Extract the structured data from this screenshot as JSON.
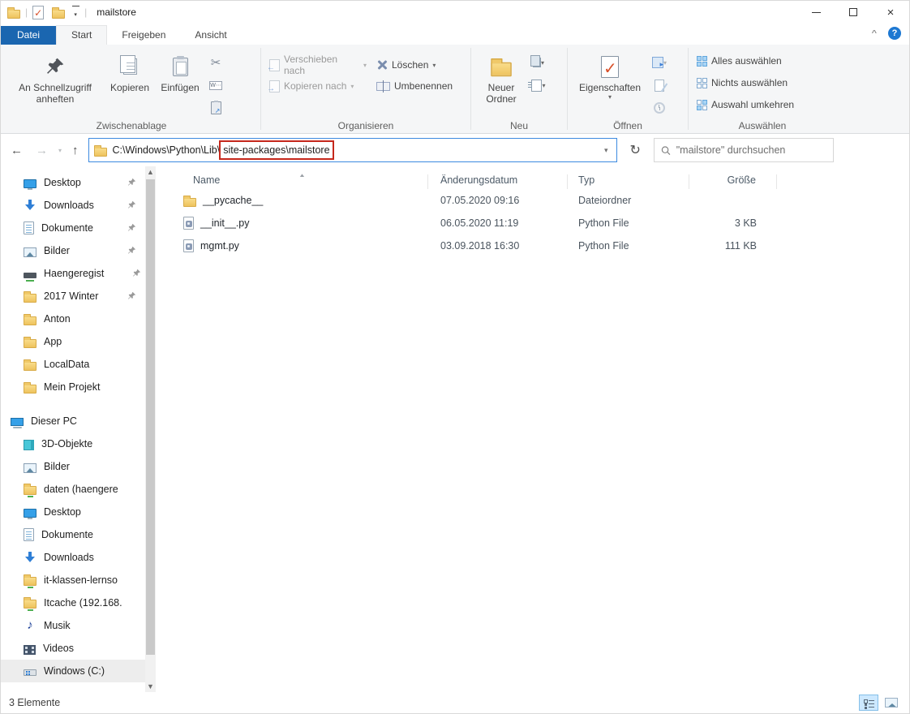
{
  "colors": {
    "file_tab_blue": "#1a66b0",
    "address_focus_border": "#3d8ae0",
    "annotation_red": "#c5281c",
    "folder_yellow": "#eec35e",
    "selected_view_bg": "#cce8ff",
    "help_badge_blue": "#1d78d2"
  },
  "titlebar": {
    "title": "mailstore",
    "qat_icons": [
      "folder-icon",
      "properties-checkmark-icon",
      "new-folder-icon",
      "customize-quick-access-dropdown"
    ]
  },
  "tabs": {
    "file": "Datei",
    "start": "Start",
    "share": "Freigeben",
    "view": "Ansicht"
  },
  "ribbon": {
    "clipboard": {
      "label": "Zwischenablage",
      "pin_quick_access": "An Schnellzugriff anheften",
      "copy": "Kopieren",
      "paste": "Einfügen"
    },
    "organize": {
      "label": "Organisieren",
      "move_to": "Verschieben nach",
      "copy_to": "Kopieren nach",
      "delete": "Löschen",
      "rename": "Umbenennen"
    },
    "new": {
      "label": "Neu",
      "new_folder": "Neuer Ordner"
    },
    "open": {
      "label": "Öffnen",
      "properties": "Eigenschaften"
    },
    "select": {
      "label": "Auswählen",
      "select_all": "Alles auswählen",
      "select_none": "Nichts auswählen",
      "invert_selection": "Auswahl umkehren"
    }
  },
  "addressbar": {
    "path_prefix": "C:\\Windows\\Python\\Lib\\",
    "path_highlighted": "site-packages\\mailstore",
    "search_placeholder": "\"mailstore\" durchsuchen"
  },
  "sidebar": {
    "items": [
      {
        "label": "Desktop",
        "icon": "monitor-icon",
        "pinned": true
      },
      {
        "label": "Downloads",
        "icon": "download-arrow-icon",
        "pinned": true
      },
      {
        "label": "Dokumente",
        "icon": "document-icon",
        "pinned": true
      },
      {
        "label": "Bilder",
        "icon": "picture-icon",
        "pinned": true
      },
      {
        "label": "Haengeregist",
        "icon": "network-drive-icon",
        "pinned": true
      },
      {
        "label": "2017 Winter",
        "icon": "folder-icon",
        "pinned": true
      },
      {
        "label": "Anton",
        "icon": "folder-icon",
        "pinned": false
      },
      {
        "label": "App",
        "icon": "folder-icon",
        "pinned": false
      },
      {
        "label": "LocalData",
        "icon": "folder-icon",
        "pinned": false
      },
      {
        "label": "Mein Projekt",
        "icon": "folder-icon",
        "pinned": false
      },
      {
        "label": "Dieser PC",
        "icon": "computer-icon",
        "pinned": false
      },
      {
        "label": "3D-Objekte",
        "icon": "cube-icon",
        "pinned": false
      },
      {
        "label": "Bilder",
        "icon": "picture-icon",
        "pinned": false
      },
      {
        "label": "daten (haengere",
        "icon": "network-folder-icon",
        "pinned": false
      },
      {
        "label": "Desktop",
        "icon": "monitor-icon",
        "pinned": false
      },
      {
        "label": "Dokumente",
        "icon": "document-icon",
        "pinned": false
      },
      {
        "label": "Downloads",
        "icon": "download-arrow-icon",
        "pinned": false
      },
      {
        "label": "it-klassen-lernso",
        "icon": "network-folder-icon",
        "pinned": false
      },
      {
        "label": "Itcache (192.168.",
        "icon": "network-folder-icon",
        "pinned": false
      },
      {
        "label": "Musik",
        "icon": "music-note-icon",
        "pinned": false
      },
      {
        "label": "Videos",
        "icon": "film-icon",
        "pinned": false
      },
      {
        "label": "Windows (C:)",
        "icon": "drive-icon",
        "pinned": false
      }
    ]
  },
  "files": {
    "columns": [
      "Name",
      "Änderungsdatum",
      "Typ",
      "Größe"
    ],
    "rows": [
      {
        "name": "__pycache__",
        "icon": "folder-icon",
        "date": "07.05.2020 09:16",
        "type": "Dateiordner",
        "size": ""
      },
      {
        "name": "__init__.py",
        "icon": "python-file-icon",
        "date": "06.05.2020 11:19",
        "type": "Python File",
        "size": "3 KB"
      },
      {
        "name": "mgmt.py",
        "icon": "python-file-icon",
        "date": "03.09.2018 16:30",
        "type": "Python File",
        "size": "111 KB"
      }
    ]
  },
  "statusbar": {
    "items_count": "3 Elemente"
  }
}
